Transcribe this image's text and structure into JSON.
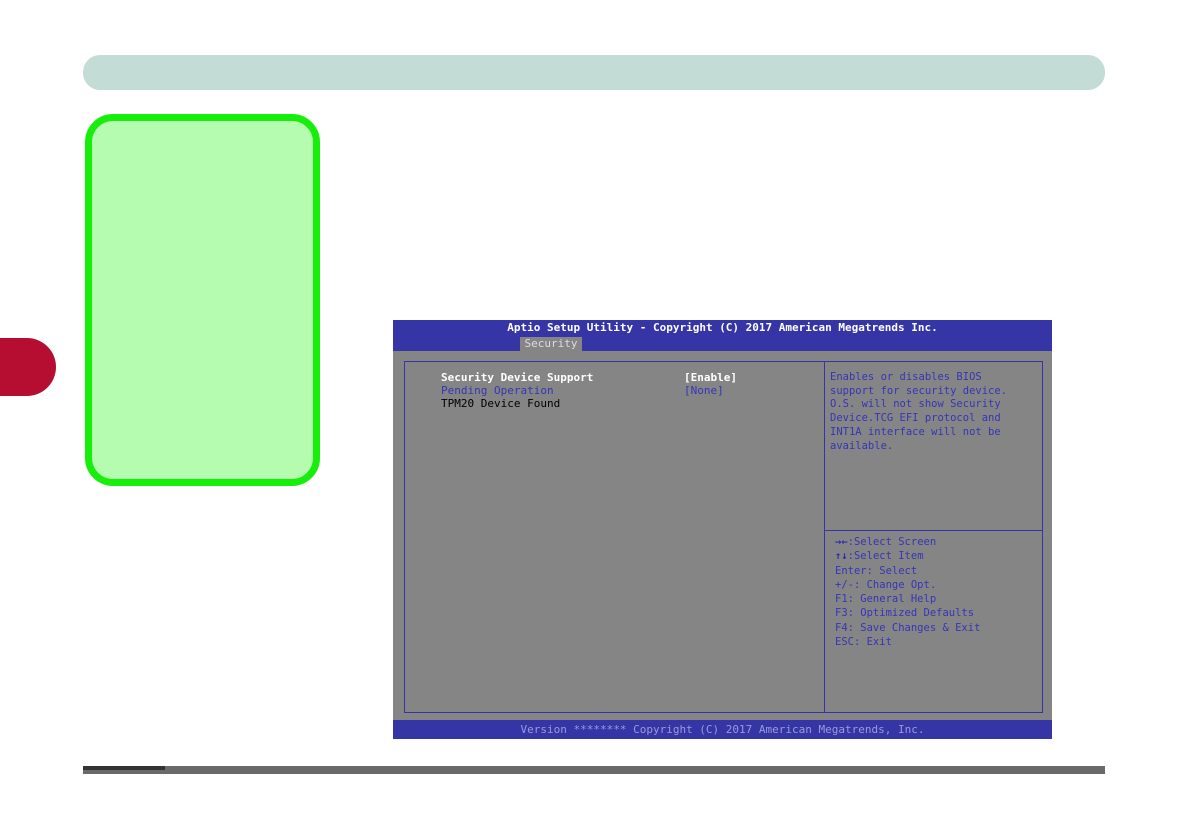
{
  "bios": {
    "title": "Aptio Setup Utility - Copyright (C) 2017 American Megatrends Inc.",
    "active_tab": "Security",
    "options": [
      {
        "label": "Security Device Support",
        "value": "[Enable]"
      },
      {
        "label": "Pending Operation",
        "value": "[None]"
      },
      {
        "label": "TPM20 Device Found",
        "value": ""
      }
    ],
    "help_lines": [
      "Enables or disables BIOS",
      "support for security device.",
      "O.S. will not show Security",
      "Device.TCG EFI protocol and",
      "INT1A interface will not be",
      "available."
    ],
    "keys": {
      "select_screen_icon": "left-right-arrows-icon",
      "select_screen": ":Select Screen",
      "select_item_icon": "up-down-arrows-icon",
      "select_item": ":Select Item",
      "enter": "Enter: Select",
      "change": "+/-: Change Opt.",
      "f1": "F1: General Help",
      "f3": "F3: Optimized Defaults",
      "f4": "F4: Save Changes & Exit",
      "esc": "ESC: Exit"
    },
    "footer": "Version ******** Copyright (C) 2017 American Megatrends, Inc."
  },
  "colors": {
    "header_bar": "#c3dcd6",
    "green_panel_fill": "#b5fcb0",
    "green_panel_border": "#17ee0c",
    "chapter_tab": "#b50e30",
    "bios_blue": "#3535a6",
    "bios_gray": "#858585"
  }
}
